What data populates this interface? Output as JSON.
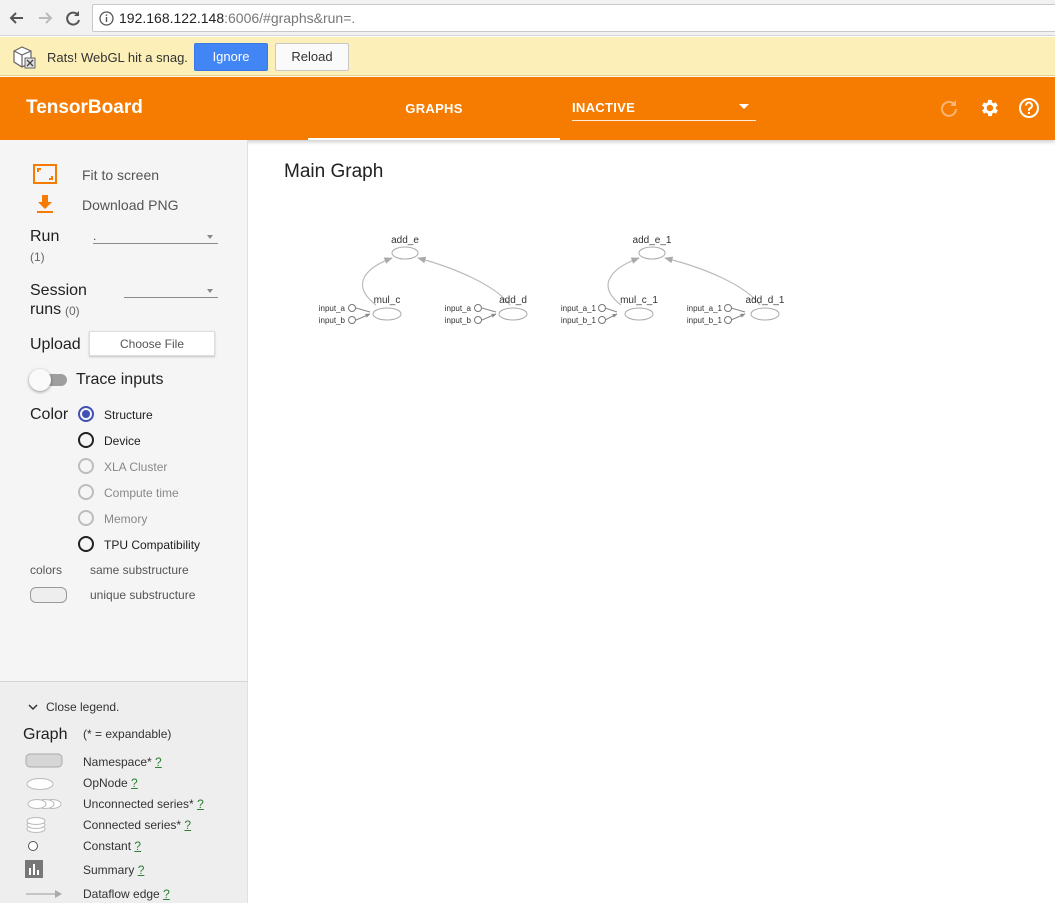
{
  "browser": {
    "url_host": "192.168.122.148",
    "url_rest": ":6006/#graphs&run=."
  },
  "infobar": {
    "message": "Rats! WebGL hit a snag.",
    "ignore_label": "Ignore",
    "reload_label": "Reload"
  },
  "header": {
    "title": "TensorBoard",
    "tab_label": "GRAPHS",
    "dropdown_label": "INACTIVE",
    "accent_color": "#f57c00"
  },
  "sidebar": {
    "fit_label": "Fit to screen",
    "download_label": "Download PNG",
    "run_label": "Run",
    "run_count": "(1)",
    "run_value": ".",
    "session_label_1": "Session",
    "session_label_2": "runs",
    "session_count": "(0)",
    "upload_label": "Upload",
    "choose_file_label": "Choose File",
    "trace_label": "Trace inputs",
    "color_label": "Color",
    "color_options": [
      {
        "label": "Structure",
        "checked": true,
        "disabled": false
      },
      {
        "label": "Device",
        "checked": false,
        "disabled": false
      },
      {
        "label": "XLA Cluster",
        "checked": false,
        "disabled": true
      },
      {
        "label": "Compute time",
        "checked": false,
        "disabled": true
      },
      {
        "label": "Memory",
        "checked": false,
        "disabled": true
      },
      {
        "label": "TPU Compatibility",
        "checked": false,
        "disabled": false
      }
    ],
    "colors_label": "colors",
    "same_substructure": "same substructure",
    "unique_substructure": "unique substructure"
  },
  "legend": {
    "close_label": "Close legend.",
    "graph_label": "Graph",
    "expandable_note": "(* = expandable)",
    "items": [
      {
        "label": "Namespace*",
        "q": "?",
        "icon": "namespace-icon"
      },
      {
        "label": "OpNode",
        "q": "?",
        "icon": "opnode-icon"
      },
      {
        "label": "Unconnected series*",
        "q": "?",
        "icon": "unconnected-series-icon"
      },
      {
        "label": "Connected series*",
        "q": "?",
        "icon": "connected-series-icon"
      },
      {
        "label": "Constant",
        "q": "?",
        "icon": "constant-icon"
      },
      {
        "label": "Summary",
        "q": "?",
        "icon": "summary-icon"
      },
      {
        "label": "Dataflow edge",
        "q": "?",
        "icon": "dataflow-edge-icon"
      }
    ]
  },
  "main": {
    "title": "Main Graph"
  },
  "graph": {
    "left": {
      "top_node": "add_e",
      "left_node": "mul_c",
      "right_node": "add_d",
      "left_inputs": [
        "input_a",
        "input_b"
      ],
      "right_inputs": [
        "input_a",
        "input_b"
      ]
    },
    "right": {
      "top_node": "add_e_1",
      "left_node": "mul_c_1",
      "right_node": "add_d_1",
      "left_inputs": [
        "input_a_1",
        "input_b_1"
      ],
      "right_inputs": [
        "input_a_1",
        "input_b_1"
      ]
    }
  }
}
